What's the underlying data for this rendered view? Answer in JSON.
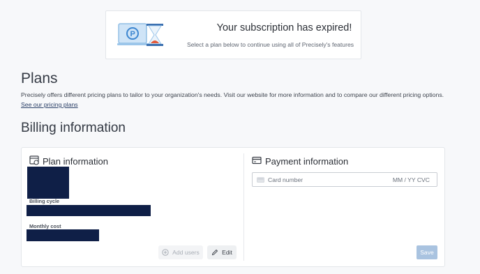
{
  "banner": {
    "title": "Your subscription has expired!",
    "subtitle": "Select a plan below to continue using all of Precisely's features"
  },
  "plans": {
    "heading": "Plans",
    "description": "Precisely offers different pricing plans to tailor to your organization's needs. Visit our website for more information and to compare our different pricing options.",
    "link": "See our pricing plans"
  },
  "billing": {
    "heading": "Billing information",
    "plan_info": {
      "title": "Plan information",
      "billing_cycle_label": "Billing cycle",
      "monthly_cost_label": "Monthly cost",
      "add_users_label": "Add users",
      "edit_label": "Edit"
    },
    "payment_info": {
      "title": "Payment information",
      "card_placeholder": "Card number",
      "expiry_cvc_placeholder": "MM / YY  CVC",
      "save_label": "Save"
    }
  },
  "colors": {
    "redaction": "#0f1f47",
    "link": "#2a3f66",
    "save_disabled": "#a9c3e0"
  },
  "icons": [
    "hourglass-laptop-illustration",
    "plan-icon",
    "card-icon",
    "add-circle-icon",
    "pencil-icon"
  ]
}
